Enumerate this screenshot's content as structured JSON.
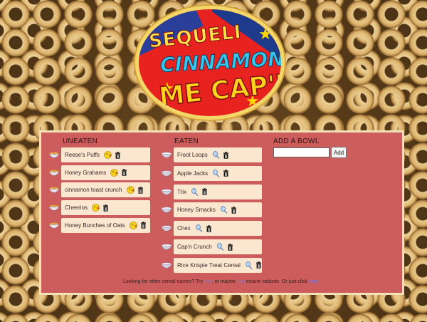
{
  "logo": {
    "line1": "SEQUELI",
    "line2": "CINNAMONIZE",
    "line3": "ME CAP'N!"
  },
  "columns": {
    "uneaten": "UNEATEN",
    "eaten": "EATEN",
    "add": "ADD A BOWL"
  },
  "uneaten": [
    {
      "name": "Reese's Puffs"
    },
    {
      "name": "Honey Grahams"
    },
    {
      "name": "cinnamon toast crunch"
    },
    {
      "name": "Cheerios"
    },
    {
      "name": "Honey Bunches of Oats"
    }
  ],
  "eaten": [
    {
      "name": "Froot Loops"
    },
    {
      "name": "Apple Jacks"
    },
    {
      "name": "Trix"
    },
    {
      "name": "Honey Smacks"
    },
    {
      "name": "Chex"
    },
    {
      "name": "Cap'n Crunch"
    },
    {
      "name": "Rice Krispie Treat Cereal"
    }
  ],
  "add_form": {
    "input_value": "",
    "placeholder": "",
    "button_label": "Add"
  },
  "footer": {
    "prefix": "Looking for other cereal names? Try ",
    "link1": "this",
    "mid1": ", or maybe ",
    "link2": "this",
    "mid2": " insane website. Or just click ",
    "link3": "here",
    "suffix": "."
  },
  "colors": {
    "panel": "#cd5c5c",
    "item": "#fbe7cf",
    "link": "#6a7af0"
  },
  "icons": {
    "uneaten_action": "eat-face-icon",
    "eaten_action": "spoon-icon",
    "delete": "trash-icon",
    "bowl_full": "cereal-bowl-icon",
    "bowl_empty": "empty-bowl-icon"
  }
}
